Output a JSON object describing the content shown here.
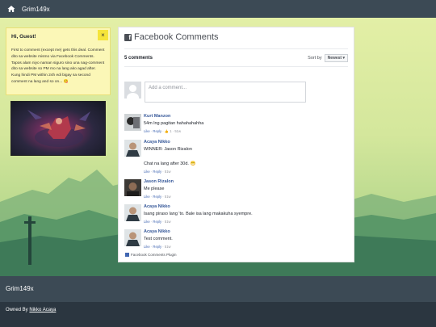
{
  "topbar": {
    "brand": "Grim149x"
  },
  "notice": {
    "title": "Hi, Guest!",
    "body": "First to comment (except me) gets this deal. Comment dito sa website mismo via Facebook Comments. Tapos alam niyo naman siguro sino una nag-comment dito sa website so PM mo na lang ako agad after. Kung hindi PM within 24h edi bigay sa second comment na lang and so on... 😋",
    "close": "×"
  },
  "comments_plugin": {
    "title": "Facebook Comments",
    "count": "5 comments",
    "sort_label": "Sort by",
    "sort_value": "Newest ▾",
    "placeholder": "Add a comment...",
    "footer": "Facebook Comments Plugin",
    "comments": [
      {
        "name": "Kurt Manzon",
        "text": "54m lng pagitan hahahahahha",
        "like": "Like",
        "reply": "Reply",
        "likes": "1",
        "time": "51w"
      },
      {
        "name": "Acaya Nikko",
        "text": "WINNER: Jason Rizalon",
        "text2": "Chat na lang after 30d. 😁",
        "like": "Like",
        "reply": "Reply",
        "time": "51w"
      },
      {
        "name": "Jason Rizalon",
        "text": "Me please",
        "like": "Like",
        "reply": "Reply",
        "time": "51w"
      },
      {
        "name": "Acaya Nikko",
        "text": "Isang piraso lang 'to. Bale isa lang makakuha syempre.",
        "like": "Like",
        "reply": "Reply",
        "time": "51w"
      },
      {
        "name": "Acaya Nikko",
        "text": "Test comment.",
        "like": "Like",
        "reply": "Reply",
        "time": "51w"
      }
    ]
  },
  "footer": {
    "brand": "Grim149x",
    "owned_by": "Owned By",
    "owner": "Nikko Acaya"
  }
}
